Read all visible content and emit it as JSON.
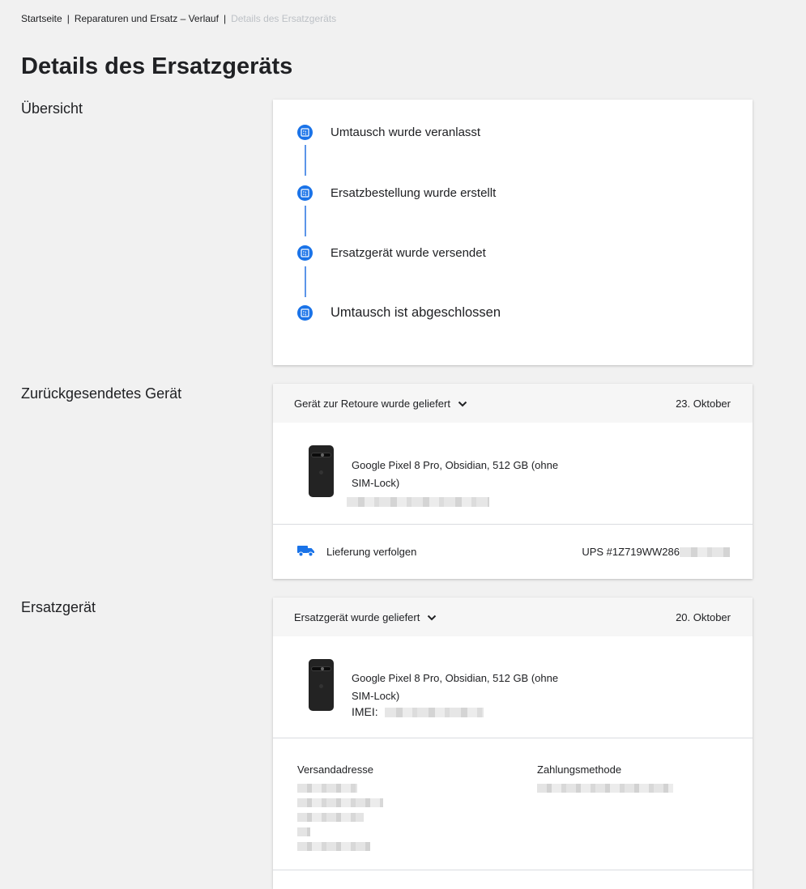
{
  "breadcrumb": {
    "home": "Startseite",
    "history": "Reparaturen und Ersatz – Verlauf",
    "current": "Details des Ersatzgeräts",
    "separator": "|"
  },
  "page_title": "Details des Ersatzgeräts",
  "sections": {
    "overview": "Übersicht",
    "returned": "Zurückgesendetes Gerät",
    "replacement": "Ersatzgerät"
  },
  "timeline": [
    {
      "label": "Umtausch wurde veranlasst",
      "icon": "checklist-icon"
    },
    {
      "label": "Ersatzbestellung wurde erstellt",
      "icon": "checklist-icon"
    },
    {
      "label": "Ersatzgerät wurde versendet",
      "icon": "checklist-icon"
    },
    {
      "label": "Umtausch ist abgeschlossen",
      "icon": "checklist-icon"
    }
  ],
  "returned_device": {
    "status": "Gerät zur Retoure wurde geliefert",
    "date": "23. Oktober",
    "product_line1": "Google Pixel 8 Pro, Obsidian, 512 GB (ohne",
    "product_line2": "SIM-Lock)",
    "tracking_label": "Lieferung verfolgen",
    "tracking_number": "UPS #1Z719WW286"
  },
  "replacement_device": {
    "status": "Ersatzgerät wurde geliefert",
    "date": "20. Oktober",
    "product_line1": "Google Pixel 8 Pro, Obsidian, 512 GB (ohne",
    "product_line2": "SIM-Lock)",
    "imei_label": "IMEI:",
    "shipping_label": "Versandadresse",
    "payment_label": "Zahlungsmethode"
  },
  "colors": {
    "accent": "#1a73e8",
    "connector": "#5c95e8",
    "background": "#f1f1f1"
  }
}
